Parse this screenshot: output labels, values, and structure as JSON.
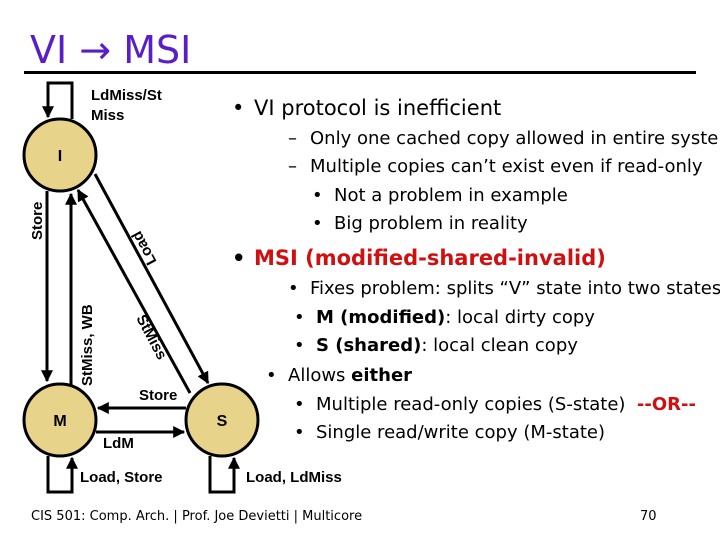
{
  "slide": {
    "title": "VI → MSI",
    "accent_color": "#5a1ec8",
    "highlight_color": "#d01010",
    "state_fill_color": "#e8d38a"
  },
  "diagram": {
    "states": {
      "I": "I",
      "M": "M",
      "S": "S"
    },
    "edge_labels": {
      "i_self": "LdMiss/St",
      "i_self_line2": "Miss",
      "i_to_m": "Store",
      "m_to_i": "StMiss, WB",
      "i_to_s": "Load",
      "s_to_i": "StMiss",
      "s_to_m": "Store",
      "m_to_s": "LdM",
      "m_self": "Load, Store",
      "s_self": "Load, LdMiss"
    }
  },
  "content": {
    "b1": "VI protocol is inefficient",
    "b1_1": "Only one cached copy allowed in entire system",
    "b1_2": "Multiple copies can’t exist even if read-only",
    "b1_2_1": "Not a problem in example",
    "b1_2_2": "Big problem in reality",
    "b2": "MSI (modified-shared-invalid)",
    "b2_1": "Fixes problem: splits “V” state into two states",
    "b2_1_1_bold": "M (modified)",
    "b2_1_1_rest": ": local dirty copy",
    "b2_1_2_bold": "S (shared)",
    "b2_1_2_rest": ": local clean copy",
    "b2_2_pre": "Allows ",
    "b2_2_bold": "either",
    "b2_2_1": "Multiple read-only copies (S-state)",
    "b2_2_1_or": "--OR--",
    "b2_2_2": "Single read/write copy (M-state)",
    "dash": "–",
    "dot": "•"
  },
  "footer": {
    "text": "CIS 501: Comp. Arch.  |  Prof. Joe Devietti  |  Multicore",
    "page": "70"
  }
}
